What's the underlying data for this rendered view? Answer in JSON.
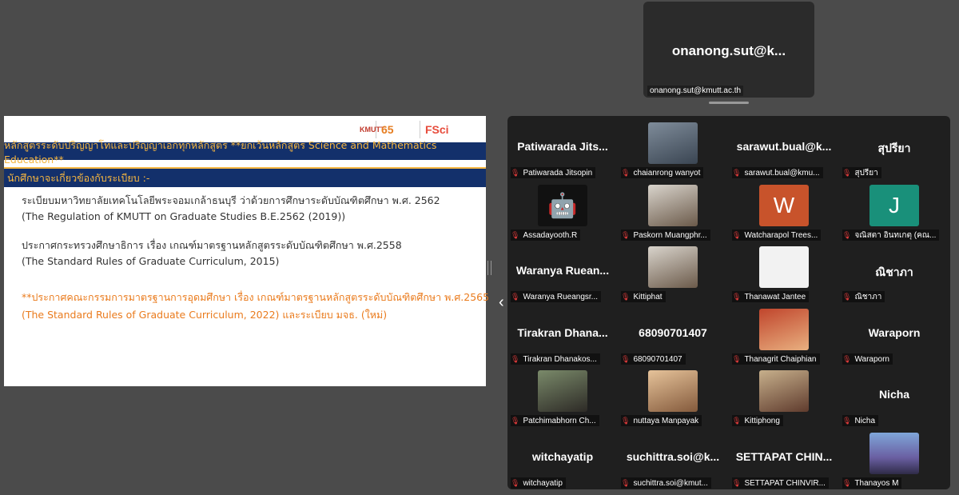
{
  "slide": {
    "logos": [
      "KMUTT",
      "65",
      "FSci"
    ],
    "band1": "หลักสูตรระดับปริญญาโทและปริญญาเอกทุกหลักสูตร **ยกเว้นหลักสูตร Science and Mathematics Education**",
    "band2": "นักศึกษาจะเกี่ยวข้องกับระเบียบ :-",
    "lines": [
      "ระเบียบมหาวิทยาลัยเทคโนโลยีพระจอมเกล้าธนบุรี ว่าด้วยการศึกษาระดับบัณฑิตศึกษา พ.ศ. 2562",
      "(The Regulation of KMUTT on Graduate Studies B.E.2562 (2019))",
      "ประกาศกระทรวงศึกษาธิการ เรื่อง เกณฑ์มาตรฐานหลักสูตรระดับบัณฑิตศึกษา พ.ศ.2558",
      "(The Standard Rules of Graduate Curriculum, 2015)",
      "**ประกาศคณะกรรมการมาตรฐานการอุดมศึกษา เรื่อง เกณฑ์มาตรฐานหลักสูตรระดับบัณฑิตศึกษา พ.ศ.2565",
      "(The Standard Rules of Graduate Curriculum, 2022)  และระเบียบ มจธ. (ใหม่)"
    ]
  },
  "speaker": {
    "name": "onanong.sut@k...",
    "email": "onanong.sut@kmutt.ac.th"
  },
  "icons": {
    "nav_prev": "‹",
    "mic_muted": "🎙"
  },
  "participants": [
    {
      "big": "Patiwarada  Jits...",
      "label": "Patiwarada Jitsopin"
    },
    {
      "av": "photo",
      "label": "chaianrong wanyot"
    },
    {
      "big": "sarawut.bual@k...",
      "label": "sarawut.bual@kmu..."
    },
    {
      "big": "สุปรียา",
      "label": "สุปรียา"
    },
    {
      "av": "robot",
      "label": "Assadayooth.R"
    },
    {
      "av": "person",
      "label": "Paskorn Muangphr..."
    },
    {
      "av": "w",
      "avtext": "W",
      "label": "Watcharapol Trees..."
    },
    {
      "av": "j",
      "avtext": "J",
      "label": "จณิสตา อินทเกตุ (คณ..."
    },
    {
      "big": "Waranya  Ruean...",
      "label": "Waranya Rueangsr..."
    },
    {
      "av": "person",
      "label": "Kittiphat"
    },
    {
      "av": "white",
      "label": "Thanawat Jantee"
    },
    {
      "big": "ณิชาภา",
      "label": "ณิชาภา"
    },
    {
      "big": "Tirakran  Dhana...",
      "label": "Tirakran Dhanakos..."
    },
    {
      "big": "68090701407",
      "label": "68090701407"
    },
    {
      "av": "red",
      "label": "Thanagrit Chaiphian"
    },
    {
      "big": "Waraporn",
      "label": "Waraporn"
    },
    {
      "av": "girl",
      "label": "Patchimabhorn Ch..."
    },
    {
      "av": "girl2",
      "label": "nuttaya Manpayak"
    },
    {
      "av": "child",
      "label": "Kittiphong"
    },
    {
      "big": "Nicha",
      "label": "Nicha"
    },
    {
      "big": "witchayatip",
      "label": "witchayatip"
    },
    {
      "big": "suchittra.soi@k...",
      "label": "suchittra.soi@kmut..."
    },
    {
      "big": "SETTAPAT  CHIN...",
      "label": "SETTAPAT CHINVIR..."
    },
    {
      "av": "mount",
      "label": "Thanayos M"
    }
  ]
}
